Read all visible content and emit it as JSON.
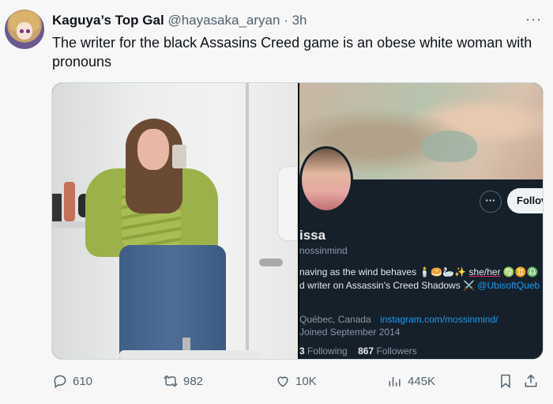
{
  "tweet": {
    "author_name": "Kaguya’s Top Gal",
    "handle": "@hayasaka_aryan",
    "separator": "·",
    "time": "3h",
    "more_icon": "···",
    "text": "The writer for the black Assasins Creed game is an obese white woman with pronouns"
  },
  "embedded_profile": {
    "name": "issa",
    "handle": "nossinmind",
    "more_label": "···",
    "follow_label": "Follov",
    "bio_line1": "naving as the wind behaves 🕯️🥯🦢✨ ",
    "pronouns": "she/her",
    "bio_line1_tail": " ♍♊♎",
    "bio_line2": "d writer on Assassin's Creed Shadows ⚔️ ",
    "bio_tag": "@UbisoftQueb",
    "location": "Québec, Canada",
    "link": "instagram.com/mossinmind/",
    "joined": "Joined September 2014",
    "following_count": "3",
    "following_label": "Following",
    "followers_count": "867",
    "followers_label": "Followers"
  },
  "actions": {
    "replies": "610",
    "retweets": "982",
    "likes": "10K",
    "views": "445K"
  },
  "icons": {
    "reply": "reply-icon",
    "retweet": "retweet-icon",
    "like": "heart-icon",
    "views": "views-icon",
    "bookmark": "bookmark-icon",
    "share": "share-icon"
  }
}
